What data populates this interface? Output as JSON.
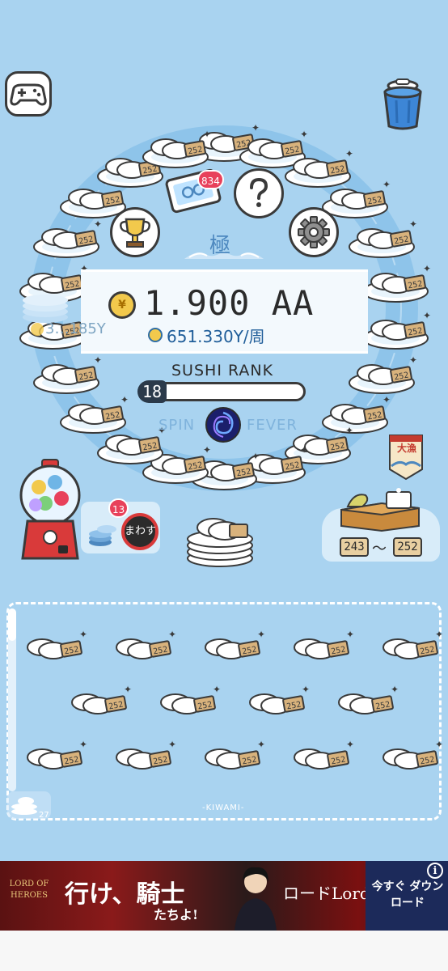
{
  "colors": {
    "background": "#a9d3f0",
    "belt": "#8ec4ea",
    "belt_inner": "#a9d3f0",
    "accent_blue": "#1f5d99",
    "badge_red": "#e8415b"
  },
  "header": {
    "gamepad_icon": "gamepad-icon",
    "trash_icon": "trash-bin-icon"
  },
  "belt": {
    "plate_tag": "252",
    "plate_count": 22
  },
  "menu": {
    "ticket_badge": "834",
    "help_symbol": "?",
    "trophy_icon": "trophy-icon",
    "settings_icon": "gear-icon",
    "rank_emblem_char": "極"
  },
  "money": {
    "amount": "1.900 AA",
    "coin_symbol": "¥",
    "rate": "651.330Y/周",
    "side_amount": "3…185Y"
  },
  "rank": {
    "label": "SUSHI RANK",
    "level": "18",
    "progress": 0.0
  },
  "fever": {
    "spin_label": "SPIN",
    "fever_label": "FEVER"
  },
  "gacha": {
    "chip_badge": "13",
    "spin_button": "まわす"
  },
  "ingredients": {
    "flag_text": "大漁",
    "range_min": "243",
    "range_sep": "〜",
    "range_max": "252"
  },
  "storage": {
    "label": "-KIWAMI-",
    "plate_count": "27",
    "item_tag": "252"
  },
  "ad": {
    "logo": "LORD OF HEROES",
    "headline": "行け、騎士",
    "subline": "たちよ!",
    "brand": "ロードLord",
    "cta": "今すぐ ダウンロード",
    "info": "i"
  }
}
